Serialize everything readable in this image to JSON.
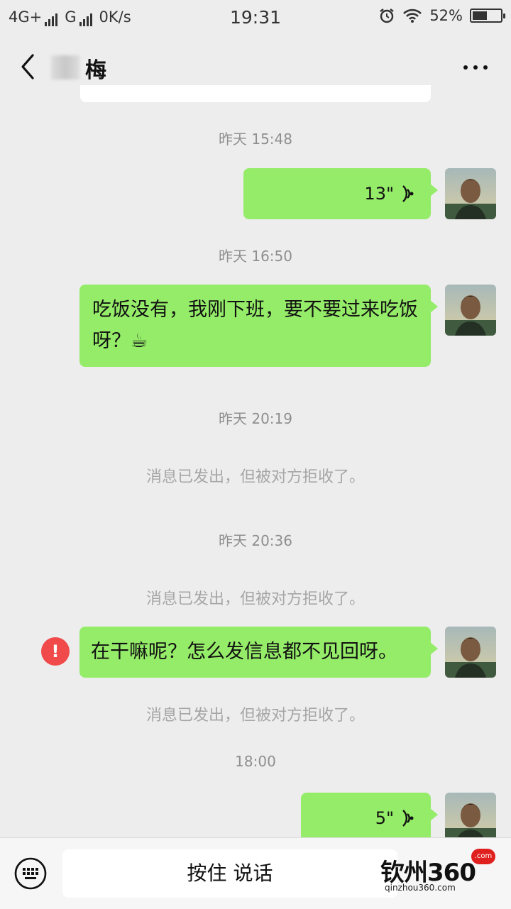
{
  "status_bar": {
    "network1": "4G+",
    "network2": "G",
    "speed": "0K/s",
    "time": "19:31",
    "battery": "52%",
    "battery_level": 0.52
  },
  "header": {
    "contact_name": "梅"
  },
  "messages": [
    {
      "time": "昨天 15:48",
      "voice_duration": "13\""
    },
    {
      "time": "昨天 16:50",
      "text": "吃饭没有，我刚下班，要不要过来吃饭呀？☕"
    },
    {
      "time": "昨天 20:19",
      "note": "消息已发出，但被对方拒收了。"
    },
    {
      "time": "昨天 20:36",
      "note": "消息已发出，但被对方拒收了。",
      "text": "在干嘛呢？怎么发信息都不见回呀。",
      "note_after": "消息已发出，但被对方拒收了。"
    },
    {
      "time": "18:00",
      "voice_duration": "5\""
    }
  ],
  "input_bar": {
    "hold_to_talk": "按住 说话"
  },
  "watermark": {
    "logo_text": "钦州360",
    "url": "qinzhou360.com",
    "badge": ".com"
  },
  "colors": {
    "bubble": "#95ec69",
    "background": "#ededed",
    "error": "#f04a4a"
  }
}
